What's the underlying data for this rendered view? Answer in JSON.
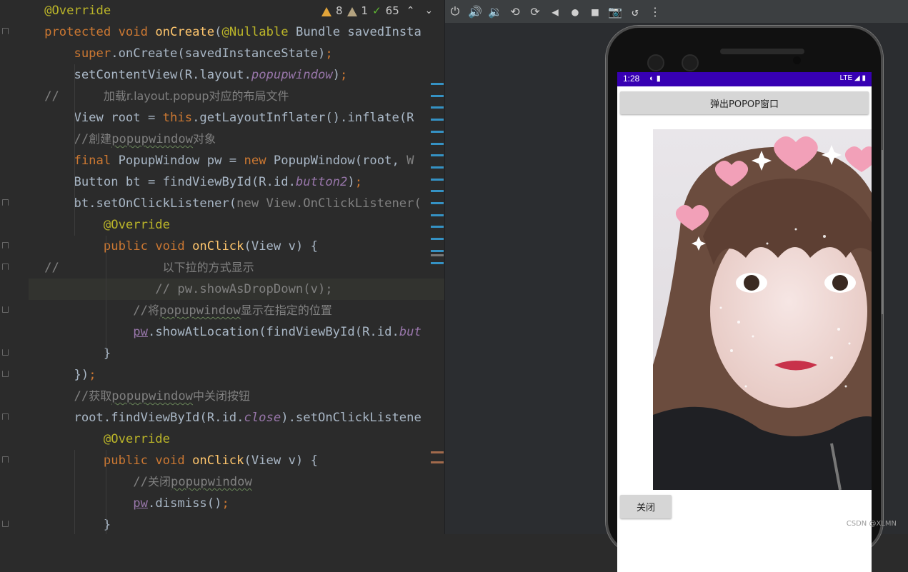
{
  "editor": {
    "inspections": {
      "warnings": "8",
      "weak_warnings": "1",
      "ok_count": "65"
    },
    "lines": [
      [
        {
          "t": "@Override",
          "c": "ann"
        }
      ],
      [
        {
          "t": "protected ",
          "c": "kw"
        },
        {
          "t": "void ",
          "c": "kw"
        },
        {
          "t": "onCreate",
          "c": "fn"
        },
        {
          "t": "(",
          "c": "txt"
        },
        {
          "t": "@Nullable ",
          "c": "ann"
        },
        {
          "t": "Bundle savedInsta",
          "c": "txt"
        }
      ],
      [
        {
          "t": "    super",
          "c": "kw"
        },
        {
          "t": ".onCreate(savedInstanceState)",
          "c": "txt"
        },
        {
          "t": ";",
          "c": "kw"
        }
      ],
      [
        {
          "t": "    setContentView(R.layout.",
          "c": "txt"
        },
        {
          "t": "popupwindow",
          "c": "field"
        },
        {
          "t": ")",
          "c": "txt"
        },
        {
          "t": ";",
          "c": "kw"
        }
      ],
      [
        {
          "t": "//      ",
          "c": "grey"
        },
        {
          "t": "加载r.layout.popup对应的布局文件",
          "c": "cn"
        }
      ],
      [
        {
          "t": "    View root = ",
          "c": "txt"
        },
        {
          "t": "this",
          "c": "kw"
        },
        {
          "t": ".getLayoutInflater().inflate(R",
          "c": "txt"
        }
      ],
      [
        {
          "t": "    //",
          "c": "grey"
        },
        {
          "t": "創建",
          "c": "cn"
        },
        {
          "t": "popupwindow",
          "c": "grey",
          "sq": true
        },
        {
          "t": "对象",
          "c": "cn"
        }
      ],
      [
        {
          "t": "    final ",
          "c": "kw"
        },
        {
          "t": "PopupWindow pw = ",
          "c": "txt"
        },
        {
          "t": "new ",
          "c": "kw"
        },
        {
          "t": "PopupWindow(root, ",
          "c": "txt"
        },
        {
          "t": "W",
          "c": "grey"
        }
      ],
      [
        {
          "t": "    Button bt = findViewById(R.id.",
          "c": "txt"
        },
        {
          "t": "button2",
          "c": "field"
        },
        {
          "t": ")",
          "c": "txt"
        },
        {
          "t": ";",
          "c": "kw"
        }
      ],
      [
        {
          "t": "    bt.setOnClickListener(",
          "c": "txt"
        },
        {
          "t": "new View.OnClickListener(",
          "c": "grey"
        }
      ],
      [
        {
          "t": "        @Override",
          "c": "ann"
        }
      ],
      [
        {
          "t": "        public ",
          "c": "kw"
        },
        {
          "t": "void ",
          "c": "kw"
        },
        {
          "t": "onClick",
          "c": "fn"
        },
        {
          "t": "(View v) {",
          "c": "txt"
        }
      ],
      [
        {
          "t": "//              ",
          "c": "grey"
        },
        {
          "t": "以下拉的方式显示",
          "c": "cn"
        }
      ],
      [
        {
          "t": "               // pw.showAsDropDown(v);",
          "c": "grey"
        }
      ],
      [
        {
          "t": "            //",
          "c": "grey"
        },
        {
          "t": "将",
          "c": "cn"
        },
        {
          "t": "popupwindow",
          "c": "grey",
          "sq": true
        },
        {
          "t": "显示在指定的位置",
          "c": "cn"
        }
      ],
      [
        {
          "t": "            ",
          "c": "txt"
        },
        {
          "t": "pw",
          "c": "field2"
        },
        {
          "t": ".showAtLocation(findViewById(R.id.",
          "c": "txt"
        },
        {
          "t": "but",
          "c": "field"
        }
      ],
      [
        {
          "t": "        }",
          "c": "txt"
        }
      ],
      [
        {
          "t": "    })",
          "c": "txt"
        },
        {
          "t": ";",
          "c": "kw"
        }
      ],
      [
        {
          "t": "    //",
          "c": "grey"
        },
        {
          "t": "获取",
          "c": "cn"
        },
        {
          "t": "popupwindow",
          "c": "grey",
          "sq": true
        },
        {
          "t": "中关闭按钮",
          "c": "cn"
        }
      ],
      [
        {
          "t": "    root.findViewById(R.id.",
          "c": "txt"
        },
        {
          "t": "close",
          "c": "field"
        },
        {
          "t": ").setOnClickListene",
          "c": "txt"
        }
      ],
      [
        {
          "t": "        @Override",
          "c": "ann"
        }
      ],
      [
        {
          "t": "        public ",
          "c": "kw"
        },
        {
          "t": "void ",
          "c": "kw"
        },
        {
          "t": "onClick",
          "c": "fn"
        },
        {
          "t": "(View v) {",
          "c": "txt"
        }
      ],
      [
        {
          "t": "            //",
          "c": "grey"
        },
        {
          "t": "关闭",
          "c": "cn"
        },
        {
          "t": "popupwindow",
          "c": "grey",
          "sq": true
        }
      ],
      [
        {
          "t": "            ",
          "c": "txt"
        },
        {
          "t": "pw",
          "c": "field2"
        },
        {
          "t": ".dismiss()",
          "c": "txt"
        },
        {
          "t": ";",
          "c": "kw"
        }
      ],
      [
        {
          "t": "        }",
          "c": "txt"
        }
      ]
    ]
  },
  "emulator": {
    "toolbar_icons": [
      "power-icon",
      "volume-up-icon",
      "volume-down-icon",
      "rotate-left-icon",
      "rotate-right-icon",
      "back-icon",
      "home-icon",
      "overview-icon",
      "camera-icon",
      "replay-icon",
      "more-icon"
    ],
    "status": {
      "time": "1:28",
      "network": "LTE"
    },
    "popup_button_label": "弹出POPOP窗口",
    "close_button_label": "关闭"
  },
  "watermark": "CSDN @XLMN"
}
